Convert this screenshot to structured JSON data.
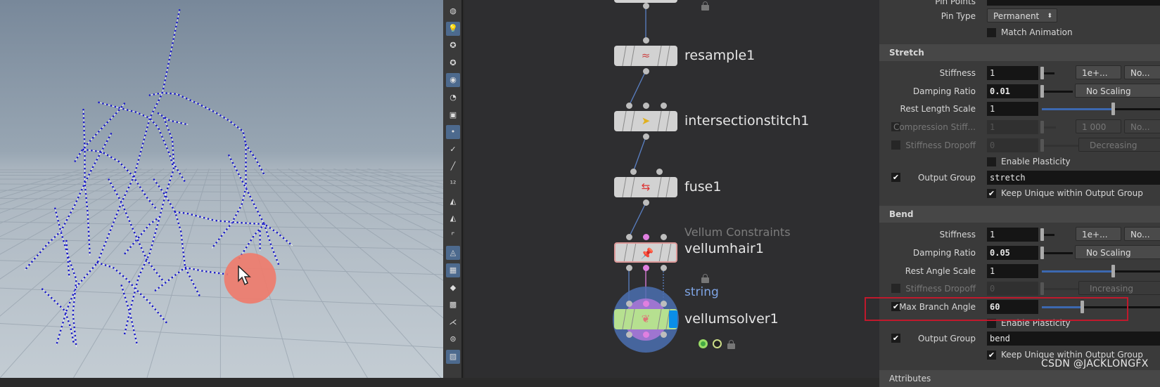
{
  "viewport": {
    "cursor_highlight_color": "#f07a6a",
    "curve_color": "#1c1cc8"
  },
  "shelf": {
    "tools": [
      "sphere-icon",
      "light-icon",
      "point-light-icon",
      "spot-light-icon",
      "camera-icon",
      "eye-icon",
      "capture-icon",
      "point-icon",
      "brush-icon",
      "pin-icon",
      "number-icon",
      "sculpt-icon",
      "sculpt-number-icon",
      "corner-icon",
      "shape-icon",
      "checker-icon",
      "diamond-icon",
      "patch-icon",
      "split-icon",
      "display-icon",
      "image-icon"
    ]
  },
  "network": {
    "nodes": [
      {
        "name": "resample1"
      },
      {
        "name": "intersectionstitch1"
      },
      {
        "name": "fuse1"
      },
      {
        "name": "vellumhair1",
        "type_label": "Vellum Constraints",
        "extra": "string"
      },
      {
        "name": "vellumsolver1"
      }
    ],
    "wire_color": "#5a80c4"
  },
  "panel": {
    "pin_points_label": "Pin Points",
    "pin_type": {
      "label": "Pin Type",
      "value": "Permanent"
    },
    "match_animation": {
      "label": "Match Animation",
      "checked": false
    },
    "stretch": {
      "title": "Stretch",
      "stiffness": {
        "label": "Stiffness",
        "value": "1",
        "exp": "1e+...",
        "scale": "No..."
      },
      "damping": {
        "label": "Damping Ratio",
        "value": "0.01",
        "scaling": "No Scaling"
      },
      "rest_length": {
        "label": "Rest Length Scale",
        "value": "1"
      },
      "compression": {
        "label": "Compression Stiff...",
        "value": "1",
        "exp": "1 000",
        "scale": "No..."
      },
      "dropoff": {
        "label": "Stiffness Dropoff",
        "value": "0",
        "mode": "Decreasing"
      },
      "plasticity": {
        "label": "Enable Plasticity"
      },
      "output_group": {
        "label": "Output Group",
        "value": "stretch"
      },
      "keep_unique": {
        "label": "Keep Unique within Output Group"
      }
    },
    "bend": {
      "title": "Bend",
      "stiffness": {
        "label": "Stiffness",
        "value": "1",
        "exp": "1e+...",
        "scale": "No..."
      },
      "damping": {
        "label": "Damping Ratio",
        "value": "0.05",
        "scaling": "No Scaling"
      },
      "rest_angle": {
        "label": "Rest Angle Scale",
        "value": "1"
      },
      "dropoff": {
        "label": "Stiffness Dropoff",
        "value": "0",
        "mode": "Increasing"
      },
      "max_branch": {
        "label": "Max Branch Angle",
        "value": "60"
      },
      "plasticity": {
        "label": "Enable Plasticity"
      },
      "output_group": {
        "label": "Output Group",
        "value": "bend"
      },
      "keep_unique": {
        "label": "Keep Unique within Output Group"
      }
    },
    "attributes_title": "Attributes",
    "highlight_color": "#c0192c"
  },
  "watermark": "CSDN @JACKLONGFX"
}
